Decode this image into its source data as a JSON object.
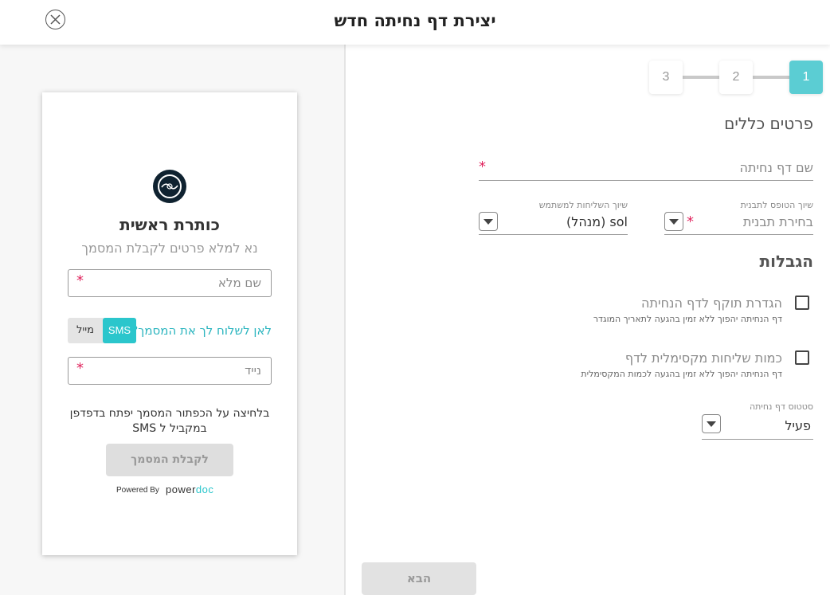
{
  "header": {
    "title": "יצירת דף נחיתה חדש"
  },
  "stepper": {
    "steps": [
      "1",
      "2",
      "3"
    ],
    "active": "1"
  },
  "general": {
    "title": "פרטים כללים",
    "name_placeholder": "שם דף נחיתה",
    "template_label": "שיוך הטופס לתבנית",
    "template_placeholder": "בחירת תבנית",
    "user_label": "שיוך השליחות למשתמש",
    "user_value": "sol (מנהל)"
  },
  "limits": {
    "title": "הגבלות",
    "expiry_title": "הגדרת תוקף לדף הנחיתה",
    "expiry_desc": "דף הנחיתה יהפוך ללא זמין בהגעה לתאריך המוגדר",
    "max_title": "כמות שליחות מקסימלית לדף",
    "max_desc": "דף הנחיתה יהפוך ללא זמין בהגעה לכמות המקסימלית"
  },
  "status": {
    "label": "סטטוס דף נחיתה",
    "value": "פעיל"
  },
  "next_button": "הבא",
  "required_mark": "*",
  "preview": {
    "title": "כותרת ראשית",
    "subtitle": "נא למלא פרטים לקבלת המסמך",
    "full_name_placeholder": "שם מלא",
    "send_question": "לאן לשלוח לך את המסמך?",
    "toggle_sms": "SMS",
    "toggle_mail": "מייל",
    "phone_placeholder": "נייד",
    "note": "בלחיצה על הכפתור המסמך יפתח בדפדפן במקביל ל SMS",
    "button": "לקבלת המסמך",
    "powered_by": "Powered By",
    "brand_a": "power",
    "brand_b": "doc"
  }
}
